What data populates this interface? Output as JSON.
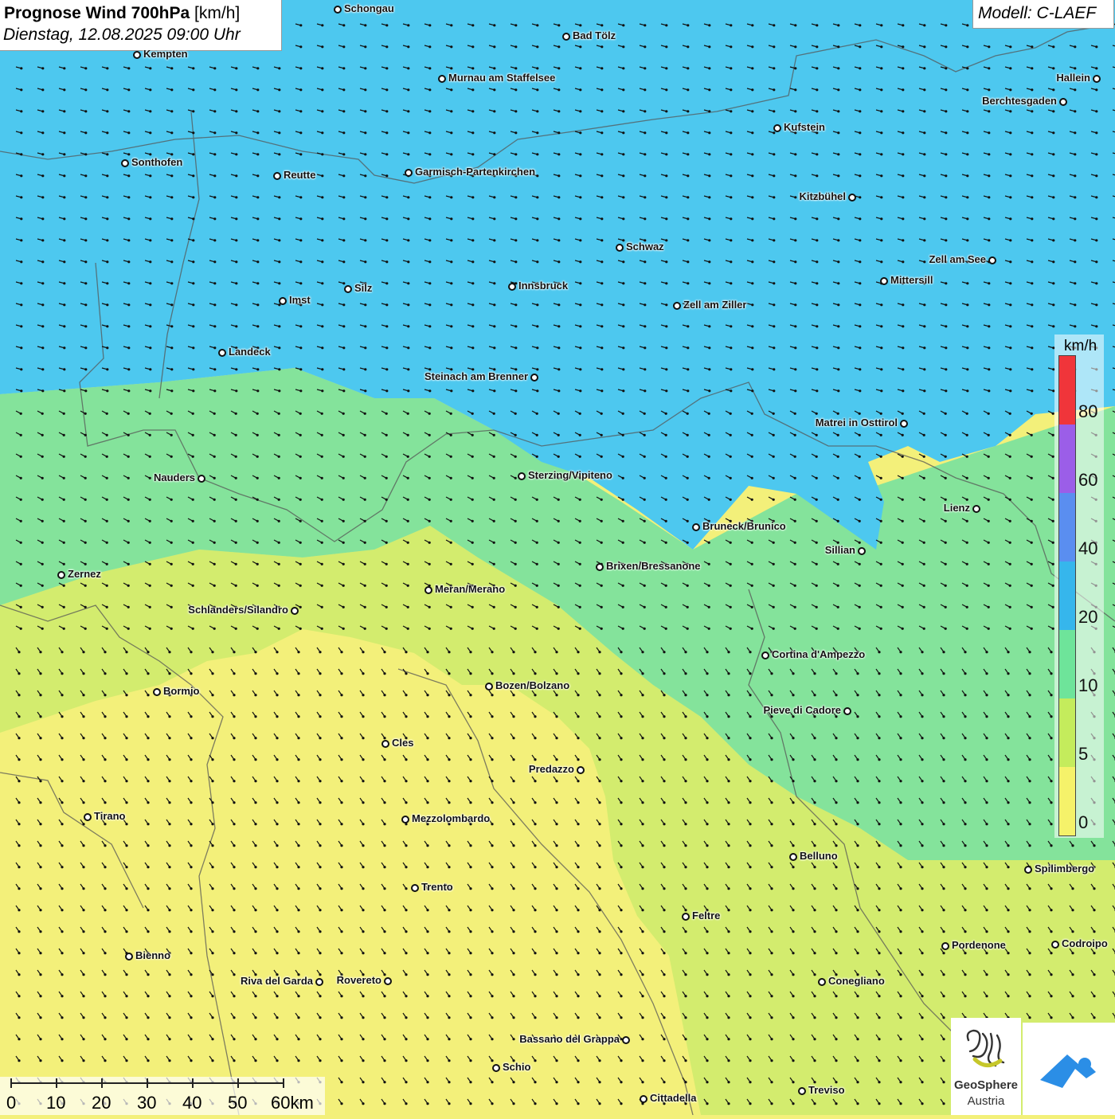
{
  "header": {
    "title_bold": "Prognose Wind 700hPa",
    "title_unit": "[km/h]",
    "datetime": "Dienstag, 12.08.2025 09:00 Uhr"
  },
  "model": {
    "label": "Modell: C-LAEF"
  },
  "legend": {
    "unit": "km/h",
    "labels": [
      "80",
      "60",
      "40",
      "20",
      "10",
      "5",
      "0"
    ],
    "colors": [
      "#f0353a",
      "#9b5ee8",
      "#5a8ef0",
      "#36b6ec",
      "#6ee49a",
      "#c4ec5c",
      "#f5f26a"
    ]
  },
  "scalebar": {
    "labels": [
      "0",
      "10",
      "20",
      "30",
      "40",
      "50",
      "60km"
    ]
  },
  "logos": {
    "geosphere_line1": "GeoSphere",
    "geosphere_line2": "Austria"
  },
  "cities": [
    {
      "name": "Schongau"
    },
    {
      "name": "Bad Tölz"
    },
    {
      "name": "Kempten"
    },
    {
      "name": "Murnau am Staffelsee"
    },
    {
      "name": "Hallein"
    },
    {
      "name": "Berchtesgaden"
    },
    {
      "name": "Kufstein"
    },
    {
      "name": "Sonthofen"
    },
    {
      "name": "Reutte"
    },
    {
      "name": "Garmisch-Partenkirchen"
    },
    {
      "name": "Kitzbühel"
    },
    {
      "name": "Schwaz"
    },
    {
      "name": "Zell am See"
    },
    {
      "name": "Mittersill"
    },
    {
      "name": "Innsbruck"
    },
    {
      "name": "Silz"
    },
    {
      "name": "Imst"
    },
    {
      "name": "Zell am Ziller"
    },
    {
      "name": "Landeck"
    },
    {
      "name": "Steinach am Brenner"
    },
    {
      "name": "Matrei in Osttirol"
    },
    {
      "name": "Nauders"
    },
    {
      "name": "Sterzing/Vipiteno"
    },
    {
      "name": "Lienz"
    },
    {
      "name": "Bruneck/Brunico"
    },
    {
      "name": "Sillian"
    },
    {
      "name": "Brixen/Bressanone"
    },
    {
      "name": "Zernez"
    },
    {
      "name": "Meran/Merano"
    },
    {
      "name": "Schlanders/Silandro"
    },
    {
      "name": "Cortina d'Ampezzo"
    },
    {
      "name": "Bozen/Bolzano"
    },
    {
      "name": "Bormio"
    },
    {
      "name": "Pieve di Cadore"
    },
    {
      "name": "Cles"
    },
    {
      "name": "Predazzo"
    },
    {
      "name": "Tirano"
    },
    {
      "name": "Mezzolombardo"
    },
    {
      "name": "Belluno"
    },
    {
      "name": "Spilimbergo"
    },
    {
      "name": "Trento"
    },
    {
      "name": "Feltre"
    },
    {
      "name": "Pordenone"
    },
    {
      "name": "Codroipo"
    },
    {
      "name": "Bienno"
    },
    {
      "name": "Riva del Garda"
    },
    {
      "name": "Rovereto"
    },
    {
      "name": "Conegliano"
    },
    {
      "name": "Bassano del Grappa"
    },
    {
      "name": "Schio"
    },
    {
      "name": "Treviso"
    },
    {
      "name": "Cittadella"
    }
  ]
}
